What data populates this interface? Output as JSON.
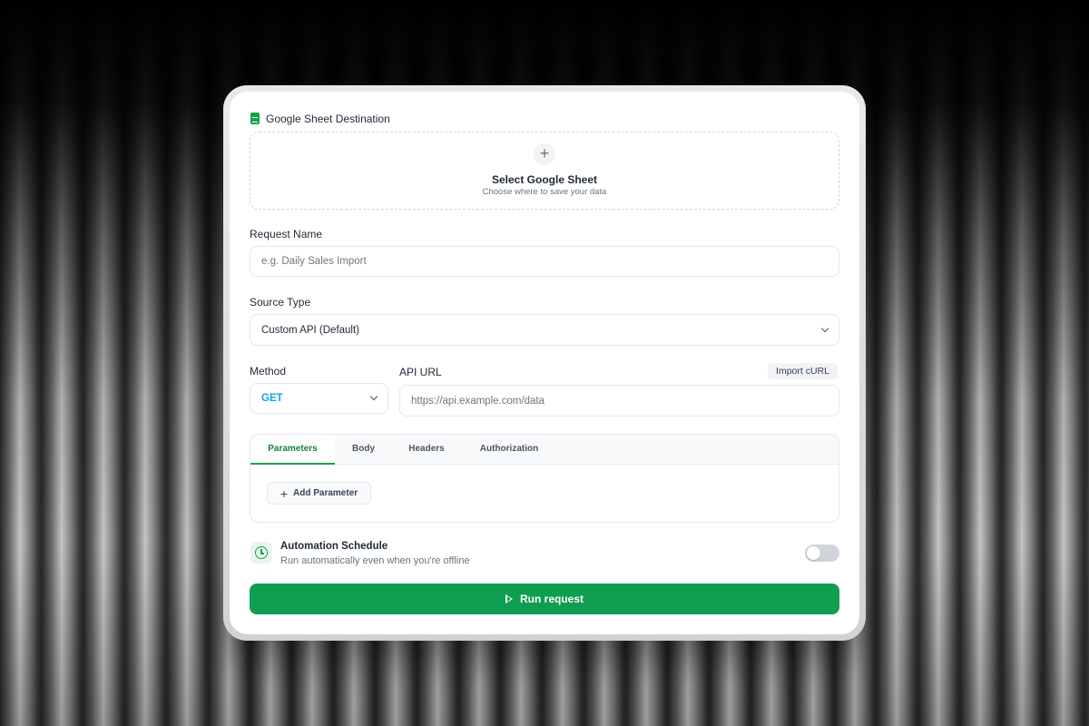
{
  "destination": {
    "title": "Google Sheet Destination",
    "select_title": "Select Google Sheet",
    "select_subtitle": "Choose where to save your data",
    "add_symbol": "+"
  },
  "request_name": {
    "label": "Request Name",
    "placeholder": "e.g. Daily Sales Import",
    "value": ""
  },
  "source_type": {
    "label": "Source Type",
    "selected": "Custom API (Default)"
  },
  "method": {
    "label": "Method",
    "selected": "GET",
    "selected_color": "#0ea5e9"
  },
  "api_url": {
    "label": "API URL",
    "placeholder": "https://api.example.com/data",
    "import_label": "Import cURL"
  },
  "tabs": [
    {
      "label": "Parameters",
      "active": true
    },
    {
      "label": "Body",
      "active": false
    },
    {
      "label": "Headers",
      "active": false
    },
    {
      "label": "Authorization",
      "active": false
    }
  ],
  "parameters": {
    "add_label": "Add Parameter"
  },
  "automation": {
    "title": "Automation Schedule",
    "subtitle": "Run automatically even when you're offline",
    "enabled": false
  },
  "run_button": {
    "label": "Run request"
  },
  "colors": {
    "accent": "#0f9d50",
    "accent_dark": "#15803d"
  }
}
